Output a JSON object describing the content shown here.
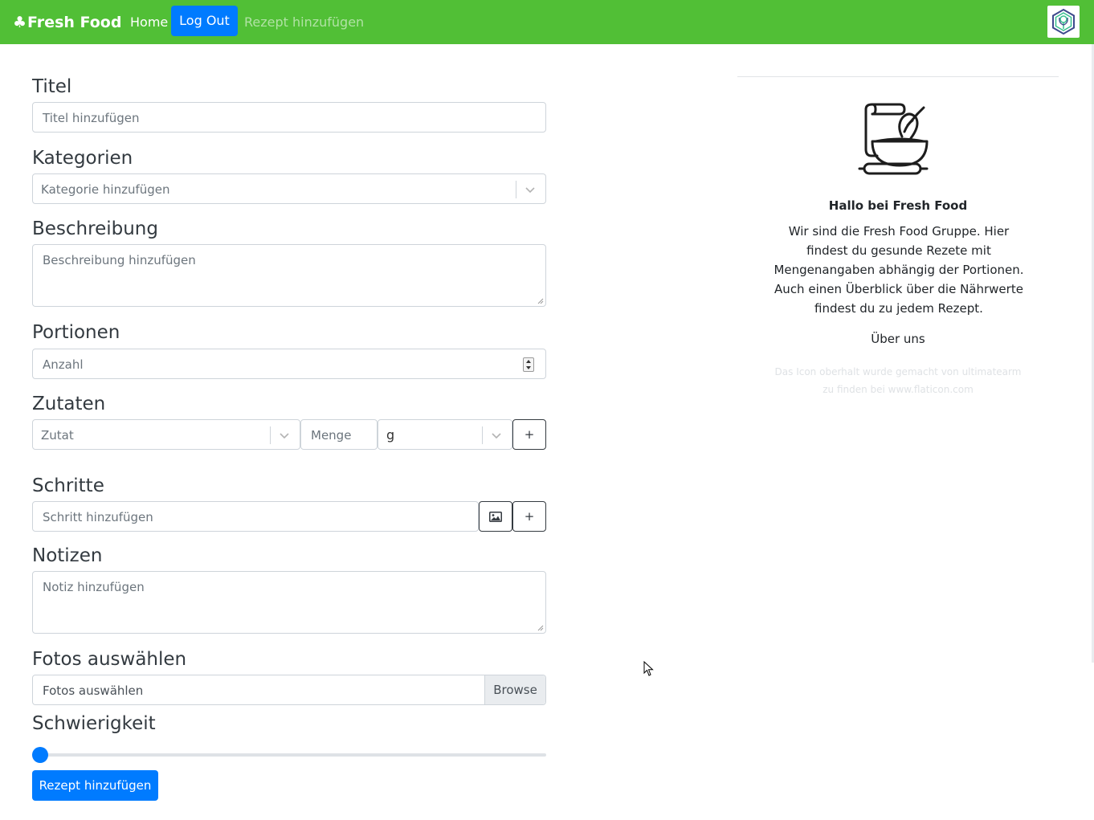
{
  "navbar": {
    "brand": "Fresh Food",
    "brand_icon": "club-icon",
    "home": "Home",
    "logout": "Log Out",
    "add_recipe": "Rezept hinzufügen",
    "brand_color": "#51bf36",
    "accent_color": "#007bff"
  },
  "form": {
    "title_label": "Titel",
    "title_placeholder": "Titel hinzufügen",
    "category_label": "Kategorien",
    "category_placeholder": "Kategorie hinzufügen",
    "description_label": "Beschreibung",
    "description_placeholder": "Beschreibung hinzufügen",
    "portions_label": "Portionen",
    "portions_placeholder": "Anzahl",
    "ingredients_label": "Zutaten",
    "ingredient_placeholder": "Zutat",
    "amount_placeholder": "Menge",
    "unit_value": "g",
    "add_symbol": "+",
    "steps_label": "Schritte",
    "step_placeholder": "Schritt hinzufügen",
    "notes_label": "Notizen",
    "notes_placeholder": "Notiz hinzufügen",
    "photos_label": "Fotos auswählen",
    "photos_placeholder": "Fotos auswählen",
    "browse": "Browse",
    "difficulty_label": "Schwierigkeit",
    "difficulty_value": 0,
    "submit": "Rezept hinzufügen"
  },
  "sidebar": {
    "hero_icon": "baking-bowl-whisk-icon",
    "heading": "Hallo bei Fresh Food",
    "description": "Wir sind die Fresh Food Gruppe. Hier findest du gesunde Rezete mit Mengenangaben abhängig der Portionen. Auch einen Überblick über die Nährwerte findest du zu jedem Rezept.",
    "about": "Über uns",
    "credit_line1": "Das Icon oberhalt wurde gemacht von ultimatearm",
    "credit_line2": "zu finden bei www.flaticon.com"
  }
}
